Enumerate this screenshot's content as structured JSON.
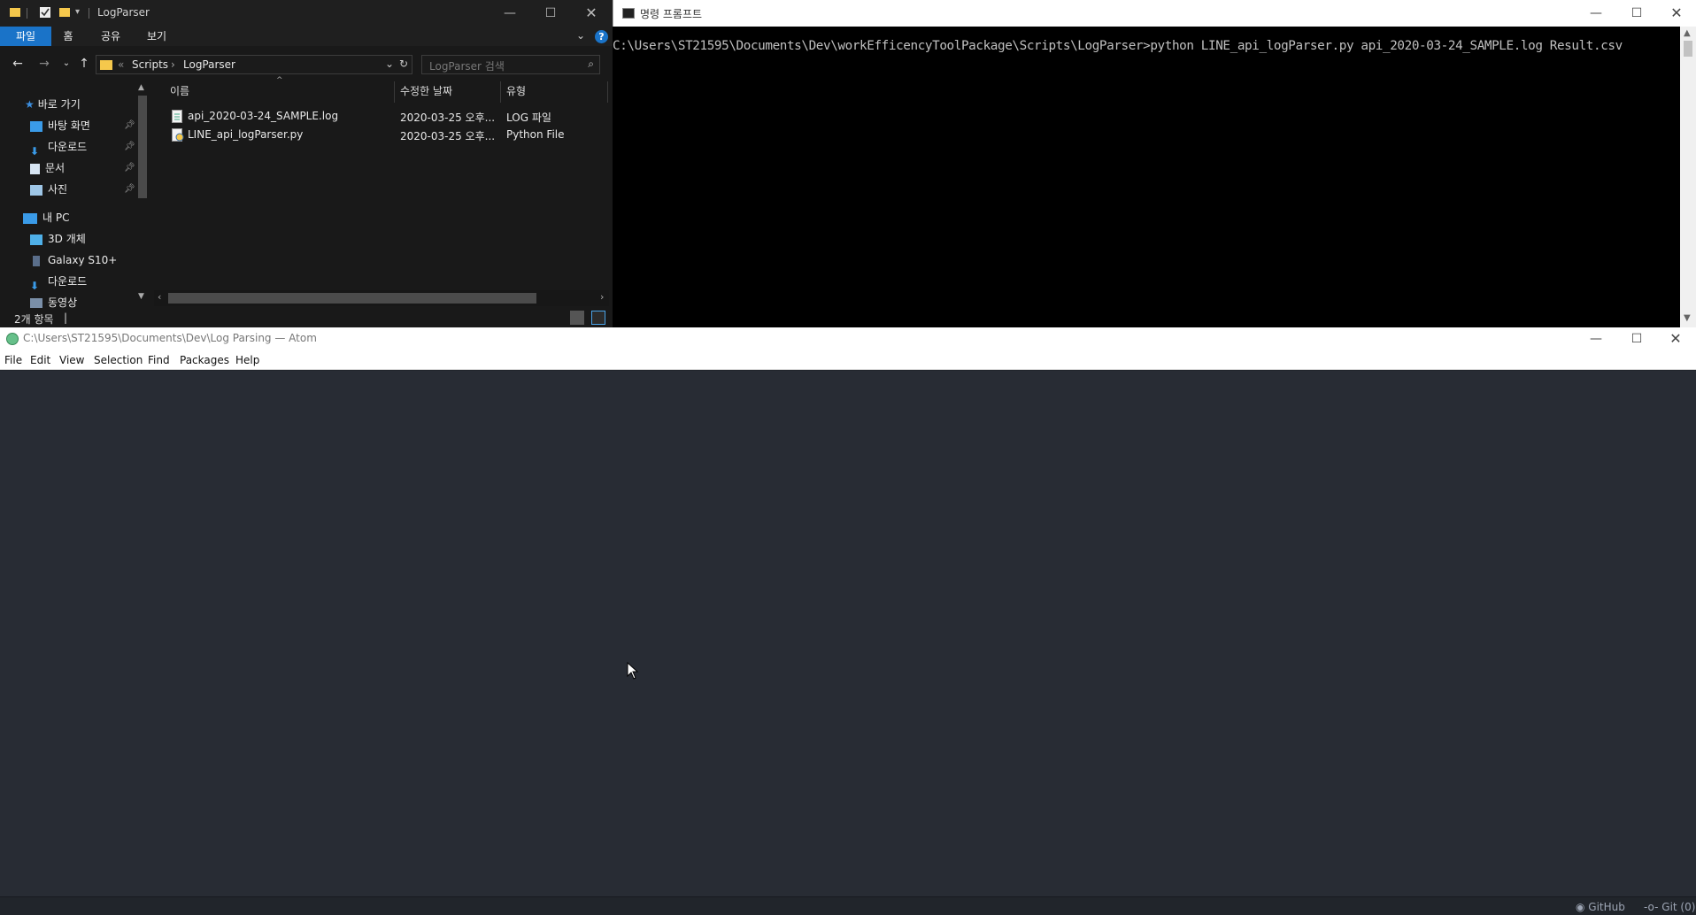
{
  "explorer": {
    "title": "LogParser",
    "ribbon_tabs": [
      "파일",
      "홈",
      "공유",
      "보기"
    ],
    "breadcrumb": [
      "«",
      "Scripts",
      "›",
      "LogParser"
    ],
    "search_placeholder": "LogParser 검색",
    "nav": {
      "quick_access": "바로 가기",
      "quick_items": [
        "바탕 화면",
        "다운로드",
        "문서",
        "사진"
      ],
      "this_pc": "내 PC",
      "pc_items": [
        "3D 개체",
        "Galaxy S10+",
        "다운로드",
        "동영상"
      ]
    },
    "columns": [
      "이름",
      "수정한 날짜",
      "유형"
    ],
    "files": [
      {
        "name": "api_2020-03-24_SAMPLE.log",
        "date": "2020-03-25 오후...",
        "type": "LOG 파일"
      },
      {
        "name": "LINE_api_logParser.py",
        "date": "2020-03-25 오후...",
        "type": "Python File"
      }
    ],
    "status": "2개 항목",
    "status_sep": "|"
  },
  "cmd": {
    "title": "명령 프롬프트",
    "line": "C:\\Users\\ST21595\\Documents\\Dev\\workEfficencyToolPackage\\Scripts\\LogParser>python LINE_api_logParser.py api_2020-03-24_SAMPLE.log Result.csv"
  },
  "atom": {
    "title": "C:\\Users\\ST21595\\Documents\\Dev\\Log Parsing — Atom",
    "menu": [
      "File",
      "Edit",
      "View",
      "Selection",
      "Find",
      "Packages",
      "Help"
    ],
    "status_github": "GitHub",
    "status_git": "Git (0)"
  },
  "colors": {
    "explorer_bg": "#191919",
    "ribbon_active": "#1a73c8",
    "atom_editor": "#282c34",
    "atom_status": "#21252b"
  }
}
